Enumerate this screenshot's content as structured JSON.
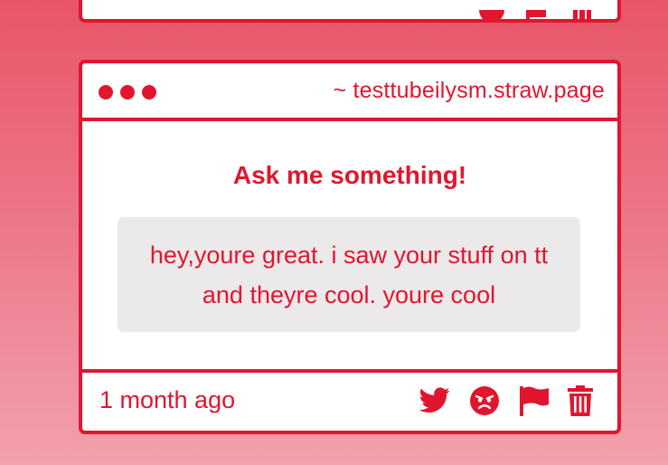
{
  "card": {
    "site_url": "~ testtubeilysm.straw.page",
    "prompt_title": "Ask me something!",
    "question_text": "hey,youre great. i saw your stuff on tt and theyre cool. youre cool",
    "timestamp": "1 month ago",
    "actions": [
      {
        "icon": "twitter-icon"
      },
      {
        "icon": "angry-face-icon"
      },
      {
        "icon": "flag-icon"
      },
      {
        "icon": "trash-icon"
      }
    ]
  },
  "theme": {
    "accent": "#e2152e",
    "card_background": "#ffffff",
    "question_background": "#ebe9ea",
    "page_gradient_top": "#e85568",
    "page_gradient_bottom": "#f2a2ad"
  }
}
